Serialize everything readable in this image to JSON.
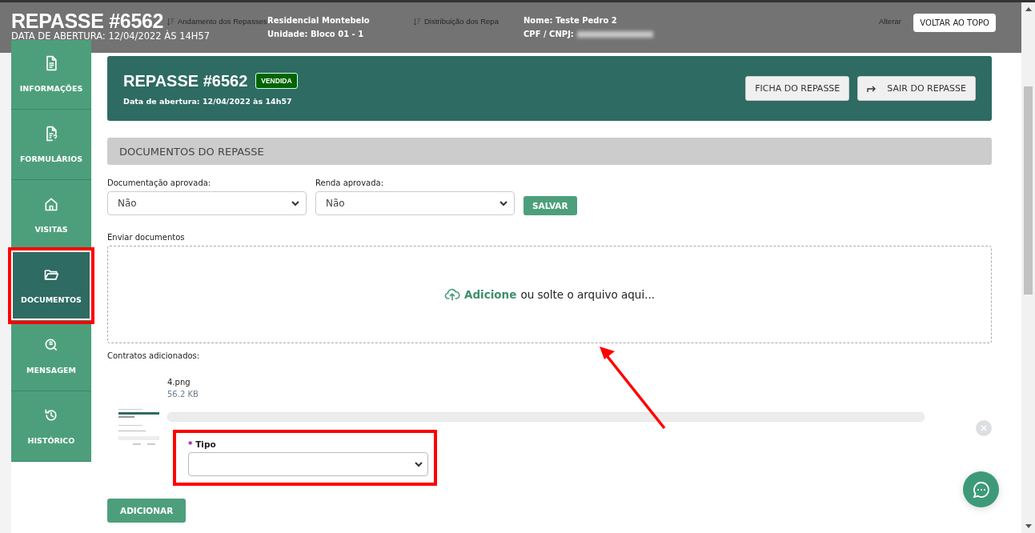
{
  "nav": {
    "items": [
      {
        "label": "Andamento dos Repasses"
      },
      {
        "label": "Distribuição dos Repa"
      }
    ],
    "right_link": "Alterar"
  },
  "header": {
    "title": "REPASSE #6562",
    "subtitle": "DATA DE ABERTURA: 12/04/2022 ÀS 14H57",
    "details": [
      {
        "label": "Residencial Montebelo"
      },
      {
        "label": "Unidade:",
        "value": "Bloco 01 - 1"
      },
      {
        "label": "Nome:",
        "value": "Teste Pedro 2"
      },
      {
        "label": "CPF / CNPJ:",
        "redacted": true
      }
    ],
    "back_to_top": "VOLTAR AO TOPO"
  },
  "sidebar": {
    "items": [
      {
        "label": "INFORMAÇÕES",
        "selected": false,
        "highlighted": false
      },
      {
        "label": "FORMULÁRIOS",
        "selected": false,
        "highlighted": false
      },
      {
        "label": "VISITAS",
        "selected": false,
        "highlighted": false
      },
      {
        "label": "DOCUMENTOS",
        "selected": true,
        "highlighted": true
      },
      {
        "label": "MENSAGEM",
        "selected": false,
        "highlighted": false
      },
      {
        "label": "HISTÓRICO",
        "selected": false,
        "highlighted": false
      }
    ]
  },
  "hero": {
    "title": "REPASSE #6562",
    "status": "VENDIDA",
    "subtitle": "Data de abertura: 12/04/2022 às 14h57",
    "buttons": [
      {
        "label": "FICHA DO REPASSE"
      },
      {
        "label": "SAIR DO REPASSE"
      }
    ]
  },
  "documents": {
    "section_title": "DOCUMENTOS DO REPASSE",
    "selects": [
      {
        "label": "Documentação aprovada:",
        "value": "Não"
      },
      {
        "label": "Renda aprovada:",
        "value": "Não"
      }
    ],
    "save_button": "SALVAR",
    "upload_label": "Enviar documentos",
    "dropzone": {
      "link": "Adicione",
      "text": "ou solte o arquivo aqui..."
    },
    "files_label": "Contratos adicionados:",
    "files": [
      {
        "name": "4.png",
        "size": "56.2 KB",
        "level": 1,
        "type_field": {
          "required_mark": "*",
          "label": "Tipo",
          "highlighted": true
        }
      }
    ],
    "add_button": "ADICIONAR"
  },
  "annotations": {
    "arrow": true
  }
}
